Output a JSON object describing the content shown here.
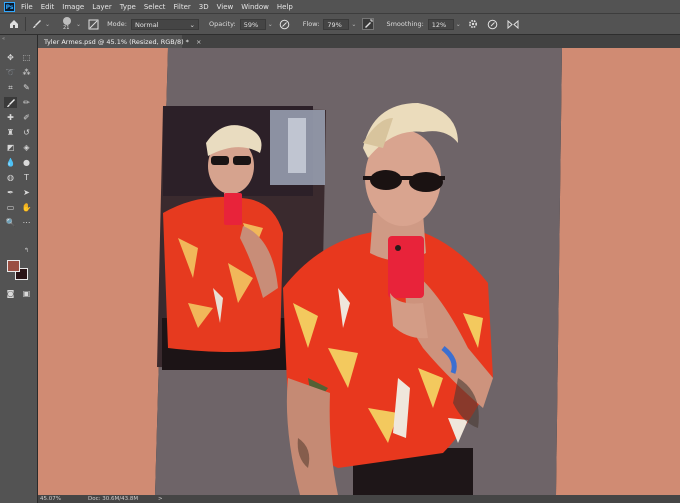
{
  "app": {
    "logo": "Ps"
  },
  "menu": [
    "File",
    "Edit",
    "Image",
    "Layer",
    "Type",
    "Select",
    "Filter",
    "3D",
    "View",
    "Window",
    "Help"
  ],
  "options": {
    "brush_size": "21",
    "mode_label": "Mode:",
    "mode_value": "Normal",
    "opacity_label": "Opacity:",
    "opacity_value": "59%",
    "flow_label": "Flow:",
    "flow_value": "79%",
    "smoothing_label": "Smoothing:",
    "smoothing_value": "12%"
  },
  "document_tab": {
    "title": "Tyler Armes.psd @ 45.1% (Resized, RGB/8) *",
    "close": "×"
  },
  "status": {
    "zoom": "45.07%",
    "doc": "Doc: 30.6M/43.8M",
    "arrow": ">"
  },
  "colors": {
    "foreground": "#9a4f42",
    "background": "#2a1416",
    "accent": "#31a8ff",
    "canvas_fill": "#d08b73",
    "canvas_center": "#6f6569"
  },
  "icons": [
    "home-icon",
    "brush-tool-icon",
    "brush-settings-icon",
    "airbrush-icon",
    "pressure-opacity-icon",
    "pressure-size-icon",
    "gear-icon",
    "symmetry-icon"
  ]
}
